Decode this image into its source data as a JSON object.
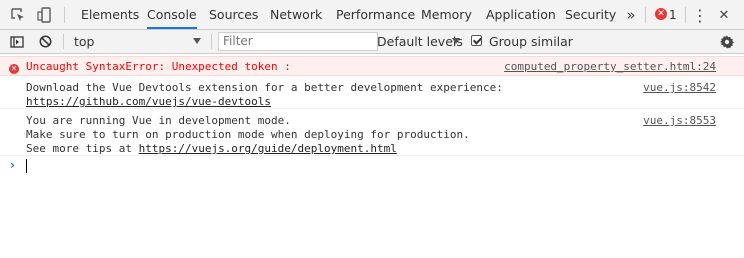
{
  "tabs": [
    "Elements",
    "Console",
    "Sources",
    "Network",
    "Performance",
    "Memory",
    "Application",
    "Security"
  ],
  "active_tab": "Console",
  "more_tabs_glyph": "»",
  "error_count": "1",
  "menu_glyph": "⋮",
  "close_glyph": "✕",
  "icons": {
    "inspect": "inspect-element-icon",
    "device": "device-toolbar-icon",
    "sidebar": "console-sidebar-icon",
    "clear": "clear-console-icon",
    "settings": "gear-icon"
  },
  "toolbar": {
    "context": "top",
    "filter_placeholder": "Filter",
    "levels": "Default levels",
    "group_similar": "Group similar",
    "group_similar_checked": true
  },
  "messages": [
    {
      "type": "error",
      "lines": [
        "Uncaught SyntaxError: Unexpected token :"
      ],
      "source": "computed_property_setter.html:24"
    },
    {
      "type": "log",
      "lines": [
        "Download the Vue Devtools extension for a better development experience:"
      ],
      "link": "https://github.com/vuejs/vue-devtools",
      "source": "vue.js:8542"
    },
    {
      "type": "log",
      "lines": [
        "You are running Vue in development mode.",
        "Make sure to turn on production mode when deploying for production."
      ],
      "prefix": "See more tips at ",
      "link": "https://vuejs.org/guide/deployment.html",
      "source": "vue.js:8553"
    }
  ],
  "prompt_glyph": "›",
  "colors": {
    "accent": "#1a73e8",
    "error_text": "#ff0000",
    "error_bg": "#fff0f0",
    "error_badge": "#e53935"
  }
}
